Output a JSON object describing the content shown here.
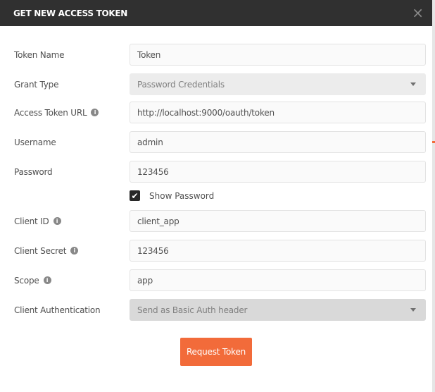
{
  "dialog": {
    "title": "GET NEW ACCESS TOKEN",
    "close_icon": "×"
  },
  "fields": [
    {
      "label": "Token Name",
      "value": "Token",
      "info": false
    },
    {
      "label": "Grant Type",
      "value": "Password Credentials",
      "type": "select"
    },
    {
      "label": "Access Token URL",
      "value": "http://localhost:9000/oauth/token",
      "info": true
    },
    {
      "label": "Username",
      "value": "admin"
    },
    {
      "label": "Password",
      "value": "123456"
    },
    {
      "label": "Client ID",
      "value": "client_app",
      "info": true
    },
    {
      "label": "Client Secret",
      "value": "123456",
      "info": true
    },
    {
      "label": "Scope",
      "value": "app",
      "info": true
    },
    {
      "label": "Client Authentication",
      "value": "Send as Basic Auth header",
      "type": "select"
    }
  ],
  "show_password": {
    "label": "Show Password",
    "checked": true
  },
  "request_button": "Request Token",
  "colors": {
    "header": "#303030",
    "accent": "#f26b3a"
  }
}
